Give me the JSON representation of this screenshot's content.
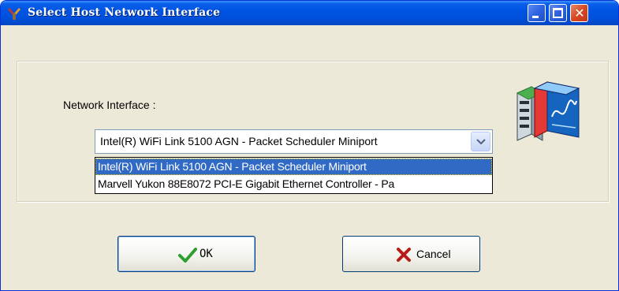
{
  "window": {
    "title": "Select Host Network Interface",
    "icon": "tools-icon"
  },
  "titlebar_buttons": {
    "minimize": "minimize-icon",
    "maximize": "maximize-icon",
    "close": "close-icon"
  },
  "form": {
    "label": "Network Interface :",
    "selected_value": "Intel(R) WiFi Link 5100 AGN - Packet Scheduler Miniport",
    "options": [
      "Intel(R) WiFi Link 5100 AGN - Packet Scheduler Miniport",
      "Marvell Yukon 88E8072 PCI-E Gigabit Ethernet Controller - Pa"
    ]
  },
  "buttons": {
    "ok_label": "OK",
    "cancel_label": "Cancel"
  },
  "colors": {
    "titlebar": "#0054e3",
    "selection": "#316ac5",
    "dialog_bg": "#ece9d8",
    "close_button": "#d64a22"
  }
}
